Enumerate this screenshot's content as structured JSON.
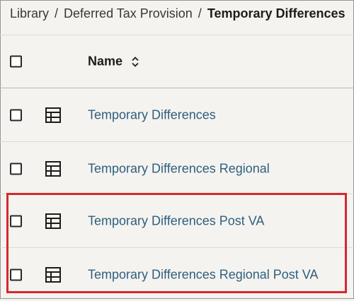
{
  "breadcrumb": {
    "items": [
      "Library",
      "Deferred Tax Provision"
    ],
    "separator": "/",
    "current": "Temporary Differences"
  },
  "table": {
    "name_header": "Name",
    "rows": [
      {
        "name": "Temporary Differences",
        "icon": "table-icon"
      },
      {
        "name": "Temporary Differences Regional",
        "icon": "table-icon"
      },
      {
        "name": "Temporary Differences Post VA",
        "icon": "table-icon"
      },
      {
        "name": "Temporary Differences Regional Post VA",
        "icon": "table-icon"
      }
    ]
  },
  "colors": {
    "link": "#2d5f7e",
    "highlight": "#d7272f",
    "background": "#f5f3f0"
  }
}
